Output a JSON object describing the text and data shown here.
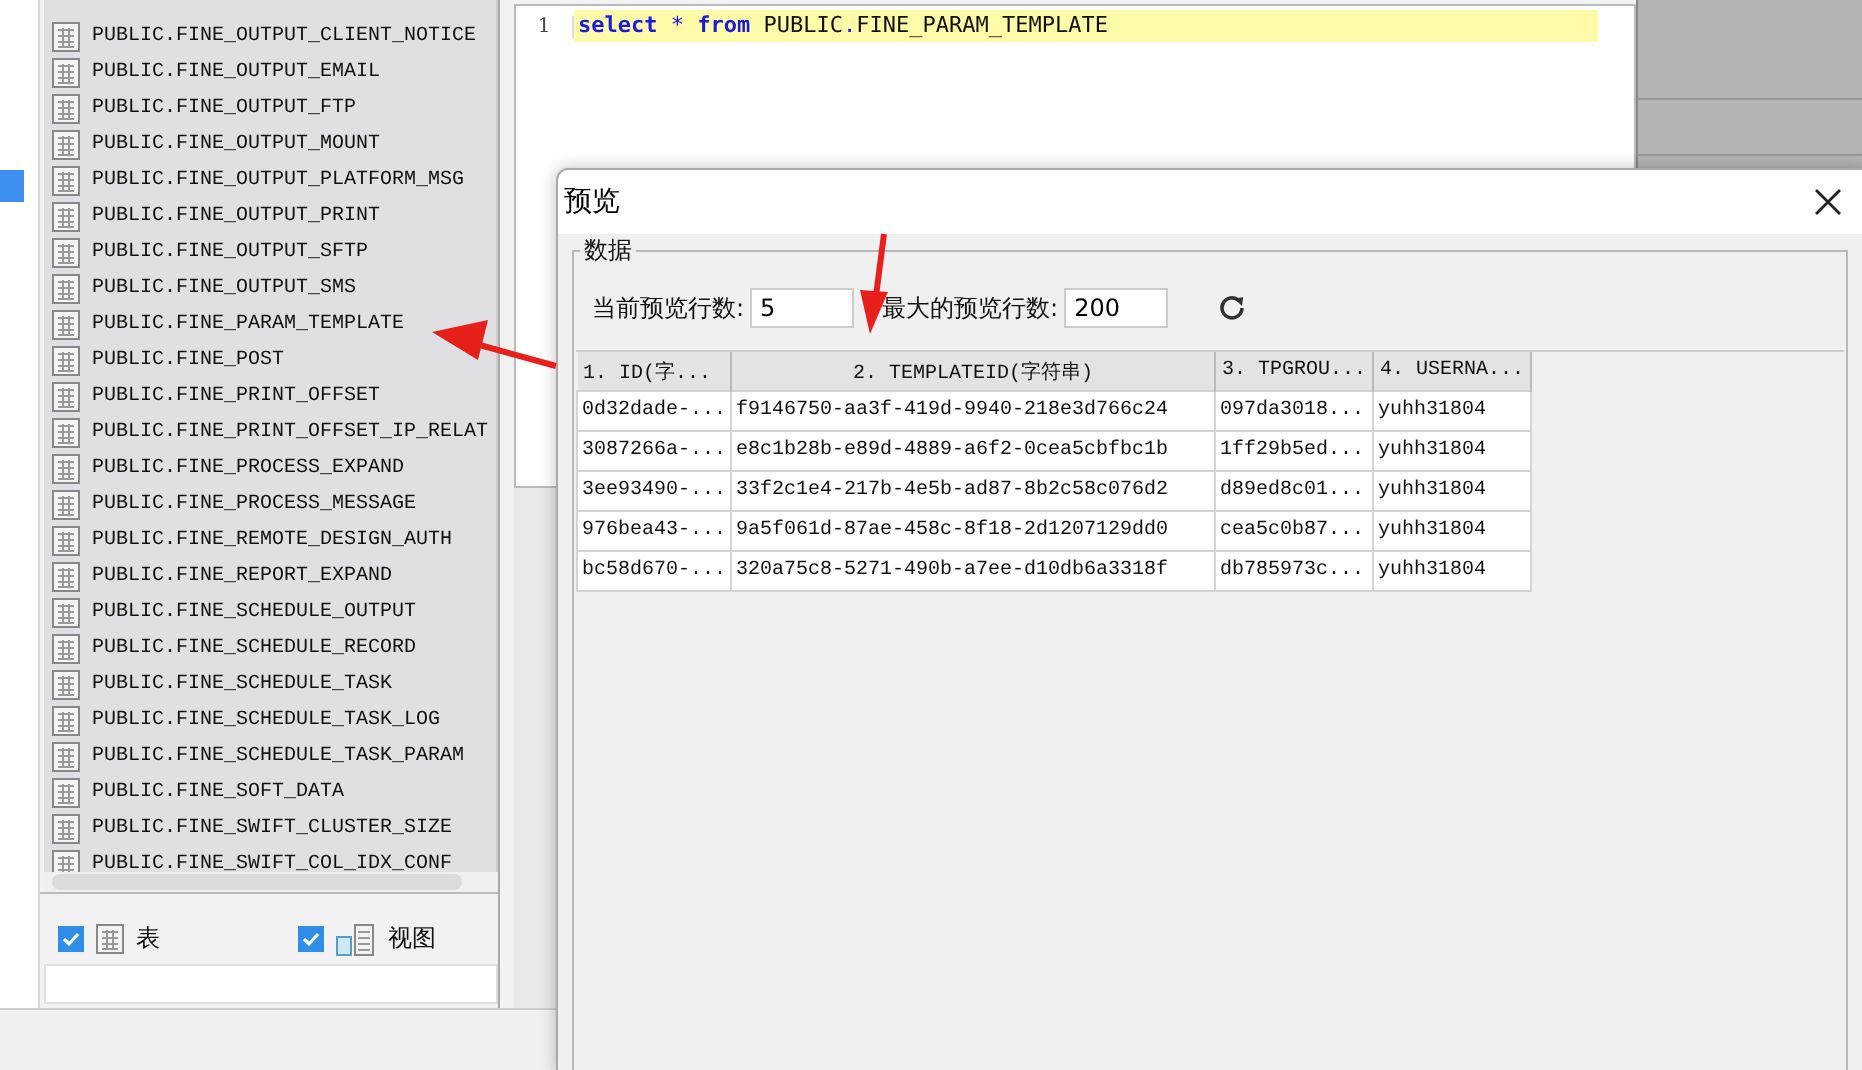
{
  "tree": {
    "items": [
      {
        "label": "PUBLIC.FINE_OUTPUT_CLIENT_NOTICE"
      },
      {
        "label": "PUBLIC.FINE_OUTPUT_EMAIL"
      },
      {
        "label": "PUBLIC.FINE_OUTPUT_FTP"
      },
      {
        "label": "PUBLIC.FINE_OUTPUT_MOUNT"
      },
      {
        "label": "PUBLIC.FINE_OUTPUT_PLATFORM_MSG"
      },
      {
        "label": "PUBLIC.FINE_OUTPUT_PRINT"
      },
      {
        "label": "PUBLIC.FINE_OUTPUT_SFTP"
      },
      {
        "label": "PUBLIC.FINE_OUTPUT_SMS"
      },
      {
        "label": "PUBLIC.FINE_PARAM_TEMPLATE"
      },
      {
        "label": "PUBLIC.FINE_POST"
      },
      {
        "label": "PUBLIC.FINE_PRINT_OFFSET"
      },
      {
        "label": "PUBLIC.FINE_PRINT_OFFSET_IP_RELAT"
      },
      {
        "label": "PUBLIC.FINE_PROCESS_EXPAND"
      },
      {
        "label": "PUBLIC.FINE_PROCESS_MESSAGE"
      },
      {
        "label": "PUBLIC.FINE_REMOTE_DESIGN_AUTH"
      },
      {
        "label": "PUBLIC.FINE_REPORT_EXPAND"
      },
      {
        "label": "PUBLIC.FINE_SCHEDULE_OUTPUT"
      },
      {
        "label": "PUBLIC.FINE_SCHEDULE_RECORD"
      },
      {
        "label": "PUBLIC.FINE_SCHEDULE_TASK"
      },
      {
        "label": "PUBLIC.FINE_SCHEDULE_TASK_LOG"
      },
      {
        "label": "PUBLIC.FINE_SCHEDULE_TASK_PARAM"
      },
      {
        "label": "PUBLIC.FINE_SOFT_DATA"
      },
      {
        "label": "PUBLIC.FINE_SWIFT_CLUSTER_SIZE"
      },
      {
        "label": "PUBLIC.FINE_SWIFT_COL_IDX_CONF"
      }
    ],
    "filters": [
      {
        "label": "表",
        "checked": true,
        "kind": "table"
      },
      {
        "label": "视图",
        "checked": true,
        "kind": "view"
      }
    ]
  },
  "editor": {
    "lines": [
      {
        "number": "1",
        "tokens": [
          {
            "text": "select",
            "kind": "keyword"
          },
          {
            "text": " * ",
            "kind": "operator"
          },
          {
            "text": "from",
            "kind": "keyword"
          },
          {
            "text": " PUBLIC",
            "kind": "plain"
          },
          {
            "text": ".",
            "kind": "operator"
          },
          {
            "text": "FINE_PARAM_TEMPLATE",
            "kind": "plain"
          }
        ]
      }
    ]
  },
  "dialog": {
    "title": "预览",
    "group": "数据",
    "current_rows": {
      "label": "当前预览行数:",
      "value": "5"
    },
    "max_rows": {
      "label": "最大的预览行数:",
      "value": "200"
    },
    "table": {
      "columns": [
        "1. ID(字...",
        "2. TEMPLATEID(字符串)",
        "3. TPGROU...",
        "4. USERNA..."
      ],
      "rows": [
        [
          "0d32dade-...",
          "f9146750-aa3f-419d-9940-218e3d766c24",
          "097da3018...",
          "yuhh31804"
        ],
        [
          "3087266a-...",
          "e8c1b28b-e89d-4889-a6f2-0cea5cbfbc1b",
          "1ff29b5ed...",
          "yuhh31804"
        ],
        [
          "3ee93490-...",
          "33f2c1e4-217b-4e5b-ad87-8b2c58c076d2",
          "d89ed8c01...",
          "yuhh31804"
        ],
        [
          "976bea43-...",
          "9a5f061d-87ae-458c-8f18-2d1207129dd0",
          "cea5c0b87...",
          "yuhh31804"
        ],
        [
          "bc58d670-...",
          "320a75c8-5271-490b-a7ee-d10db6a3318f",
          "db785973c...",
          "yuhh31804"
        ]
      ]
    }
  }
}
